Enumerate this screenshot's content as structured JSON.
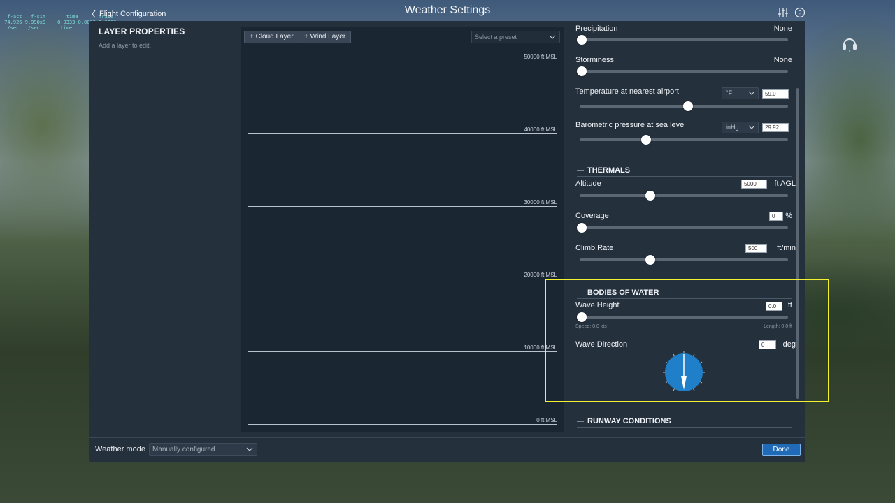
{
  "colors": {
    "accent_blue": "#1f6bb8",
    "compass_blue": "#1f7fc8",
    "highlight_yellow": "#f2f232",
    "dialog_bg": "#25303d",
    "graph_bg": "#1b2633"
  },
  "debug_overlay": "  f-act   f-sim       time       frame\n 74.926 9.990x9    0.0333 0.0003 0.0000\n  /sec   /sec       time",
  "header": {
    "back_label": "Flight Configuration",
    "title": "Weather Settings",
    "icons": [
      "sliders-icon",
      "help-icon"
    ]
  },
  "layer_panel": {
    "title": "LAYER PROPERTIES",
    "hint": "Add a layer to edit."
  },
  "graph": {
    "add_cloud_label": "+ Cloud Layer",
    "add_wind_label": "+ Wind Layer",
    "preset_placeholder": "Select a preset",
    "altitude_labels": [
      "50000 ft MSL",
      "40000 ft MSL",
      "30000 ft MSL",
      "20000 ft MSL",
      "10000 ft MSL",
      "0 ft MSL"
    ]
  },
  "settings": {
    "precipitation": {
      "label": "Precipitation",
      "value": "None",
      "level": 0.0
    },
    "storminess": {
      "label": "Storminess",
      "value": "None",
      "level": 0.0
    },
    "temperature": {
      "label": "Temperature at nearest airport",
      "unit": "°F",
      "value": "59.0",
      "level": 0.51
    },
    "pressure": {
      "label": "Barometric pressure at sea level",
      "unit": "inHg",
      "value": "29.92",
      "level": 0.31
    },
    "thermals": {
      "heading": "THERMALS",
      "altitude": {
        "label": "Altitude",
        "value": "5000",
        "unit": "ft AGL",
        "level": 0.33
      },
      "coverage": {
        "label": "Coverage",
        "value": "0",
        "unit": "%",
        "level": 0.0
      },
      "climb_rate": {
        "label": "Climb Rate",
        "value": "500",
        "unit": "ft/min",
        "level": 0.33
      }
    },
    "water": {
      "heading": "BODIES OF WATER",
      "wave_height": {
        "label": "Wave Height",
        "value": "0.0",
        "unit": "ft",
        "level": 0.0
      },
      "speed_note": "Speed: 0.0 kts",
      "length_note": "Length: 0.0 ft",
      "wave_direction": {
        "label": "Wave Direction",
        "value": "0",
        "unit": "deg"
      }
    },
    "runway": {
      "heading": "RUNWAY CONDITIONS"
    }
  },
  "footer": {
    "weather_mode_label": "Weather mode",
    "weather_mode_value": "Manually configured",
    "done_label": "Done"
  }
}
